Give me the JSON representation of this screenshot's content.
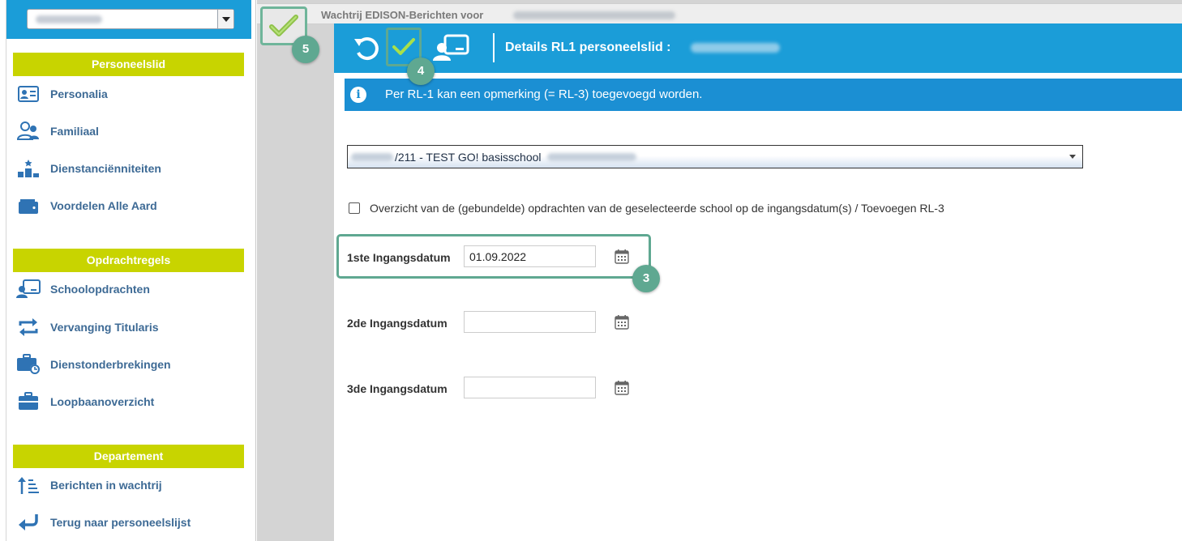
{
  "sidebar": {
    "user_select": {
      "value": ""
    },
    "sections": [
      {
        "title": "Personeelslid",
        "items": [
          {
            "label": "Personalia",
            "icon": "id-card-icon"
          },
          {
            "label": "Familiaal",
            "icon": "family-icon"
          },
          {
            "label": "Dienstanciënniteiten",
            "icon": "podium-icon"
          },
          {
            "label": "Voordelen Alle Aard",
            "icon": "wallet-icon"
          }
        ]
      },
      {
        "title": "Opdrachtregels",
        "items": [
          {
            "label": "Schoolopdrachten",
            "icon": "teacher-board-icon"
          },
          {
            "label": "Vervanging Titularis",
            "icon": "swap-arrows-icon"
          },
          {
            "label": "Dienstonderbrekingen",
            "icon": "briefcase-clock-icon"
          },
          {
            "label": "Loopbaanoverzicht",
            "icon": "briefcase-icon"
          }
        ]
      },
      {
        "title": "Departement",
        "items": [
          {
            "label": "Berichten in wachtrij",
            "icon": "sort-list-icon"
          },
          {
            "label": "Terug naar personeelslijst",
            "icon": "return-arrow-icon"
          }
        ]
      }
    ]
  },
  "queue": {
    "title": "Wachtrij EDISON-Berichten voor",
    "badge": "5"
  },
  "panel": {
    "title": "Details RL1 personeelslid :",
    "confirm_badge": "4",
    "info": "Per RL-1 kan een opmerking (= RL-3) toegevoegd worden.",
    "school_select": {
      "value": "/211 - TEST GO! basisschool"
    },
    "overview_checkbox": {
      "label": "Overzicht van de (gebundelde) opdrachten van de geselecteerde school op de ingangsdatum(s) / Toevoegen RL-3",
      "checked": false
    },
    "dates": [
      {
        "label": "1ste Ingangsdatum",
        "value": "01.09.2022"
      },
      {
        "label": "2de Ingangsdatum",
        "value": ""
      },
      {
        "label": "3de Ingangsdatum",
        "value": ""
      }
    ],
    "date_badge": "3"
  },
  "colors": {
    "accent_blue": "#1b9dd8",
    "info_blue": "#1b8fd3",
    "section_green": "#c8d400",
    "badge_green": "#5fa891",
    "link_blue": "#3d6a95"
  }
}
